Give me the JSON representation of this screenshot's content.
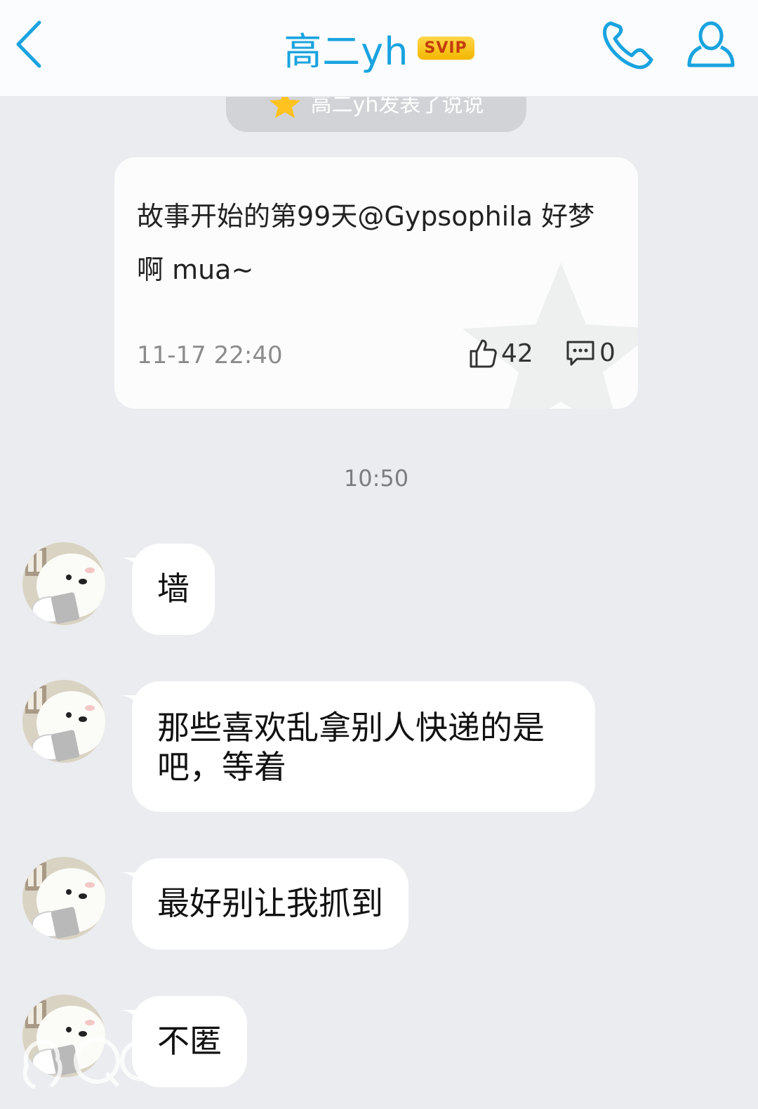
{
  "header": {
    "title": "高二yh",
    "badge": "SVIP",
    "accent_color": "#19a3e0"
  },
  "notice": {
    "text": "高二yh发表了说说",
    "icon": "qzone-star-icon"
  },
  "post_card": {
    "text": "故事开始的第99天@Gypsophila 好梦啊 mua~",
    "time": "11-17 22:40",
    "likes": "42",
    "comments": "0"
  },
  "timestamp": "10:50",
  "messages": [
    {
      "text": "墙"
    },
    {
      "text": "那些喜欢乱拿别人快递的是吧，等着"
    },
    {
      "text": "最好别让我抓到"
    },
    {
      "text": "不匿"
    }
  ],
  "watermark": "QQ"
}
